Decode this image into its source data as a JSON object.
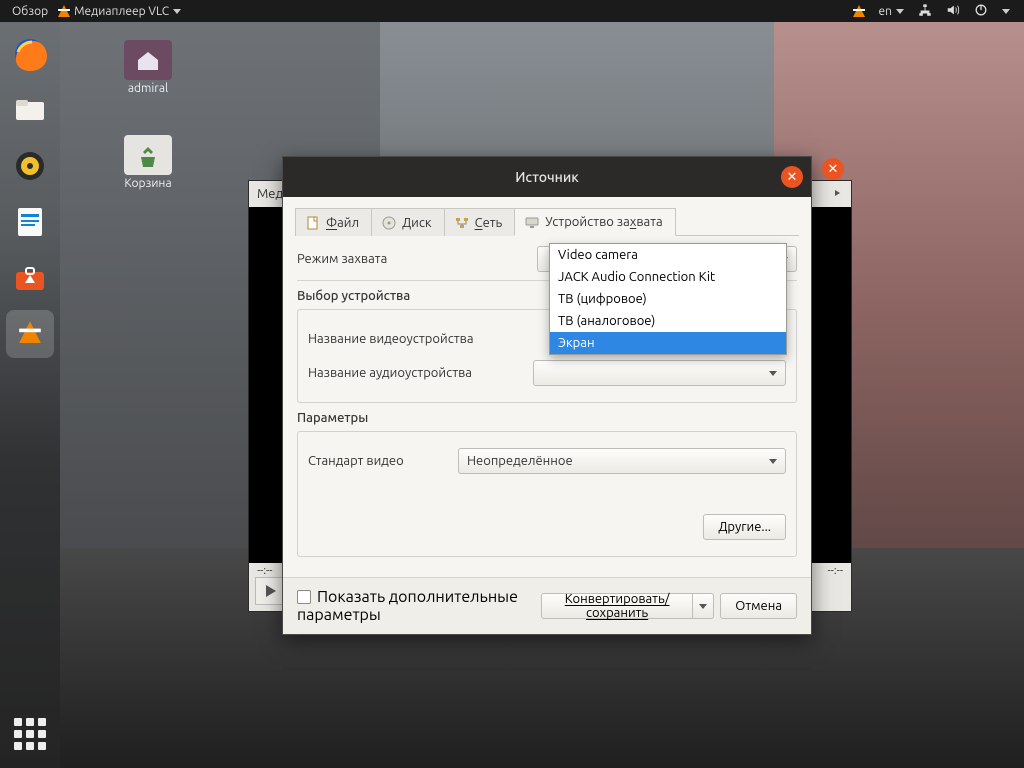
{
  "topbar": {
    "activities": "Обзор",
    "app_label": "Медиаплеер VLC",
    "lang": "en"
  },
  "desktop": {
    "home": "admiral",
    "trash": "Корзина"
  },
  "vlc": {
    "menu_media_trunc": "Мед",
    "time_left": "--:--",
    "time_right": "--:--"
  },
  "dialog": {
    "title": "Источник",
    "tabs": {
      "file": "айл",
      "file_ul": "Ф",
      "disc": "иск",
      "disc_ul": "Д",
      "net": "еть",
      "net_ul": "С",
      "capture": "Устройство за",
      "capture_ul": "х",
      "capture_rest": "вата"
    },
    "capture_mode_label": "Режим захвата",
    "device_selection_label": "Выбор устройства",
    "video_device_label": "Название видеоустройства",
    "audio_device_label": "Название аудиоустройства",
    "params_label": "Параметры",
    "video_standard_label": "Стандарт видео",
    "video_standard_value": "Неопределённое",
    "more_btn": "Другие...",
    "show_more_opts": "Показать дополнительные параметры",
    "convert_btn": "Конвертировать/сохранить",
    "cancel_btn": "Отмена"
  },
  "capture_modes": {
    "options": [
      "Video camera",
      "JACK Audio Connection Kit",
      "ТВ (цифровое)",
      "ТВ (аналоговое)",
      "Экран"
    ],
    "selected_index": 4
  }
}
